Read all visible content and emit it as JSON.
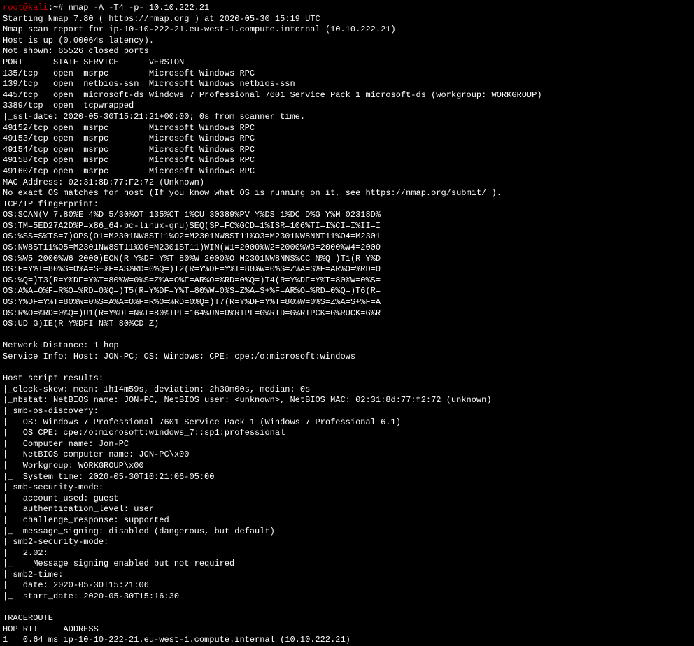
{
  "prompt": {
    "user": "root@kali",
    "cwd": "~",
    "hash": "#",
    "command": "nmap -A -T4 -p- 10.10.222.21"
  },
  "lines": [
    "Starting Nmap 7.80 ( https://nmap.org ) at 2020-05-30 15:19 UTC",
    "Nmap scan report for ip-10-10-222-21.eu-west-1.compute.internal (10.10.222.21)",
    "Host is up (0.00064s latency).",
    "Not shown: 65526 closed ports",
    "PORT      STATE SERVICE      VERSION",
    "135/tcp   open  msrpc        Microsoft Windows RPC",
    "139/tcp   open  netbios-ssn  Microsoft Windows netbios-ssn",
    "445/tcp   open  microsoft-ds Windows 7 Professional 7601 Service Pack 1 microsoft-ds (workgroup: WORKGROUP)",
    "3389/tcp  open  tcpwrapped",
    "|_ssl-date: 2020-05-30T15:21:21+00:00; 0s from scanner time.",
    "49152/tcp open  msrpc        Microsoft Windows RPC",
    "49153/tcp open  msrpc        Microsoft Windows RPC",
    "49154/tcp open  msrpc        Microsoft Windows RPC",
    "49158/tcp open  msrpc        Microsoft Windows RPC",
    "49160/tcp open  msrpc        Microsoft Windows RPC",
    "MAC Address: 02:31:8D:77:F2:72 (Unknown)",
    "No exact OS matches for host (If you know what OS is running on it, see https://nmap.org/submit/ ).",
    "TCP/IP fingerprint:",
    "OS:SCAN(V=7.80%E=4%D=5/30%OT=135%CT=1%CU=30389%PV=Y%DS=1%DC=D%G=Y%M=02318D%",
    "OS:TM=5ED27A2D%P=x86_64-pc-linux-gnu)SEQ(SP=FC%GCD=1%ISR=106%TI=I%CI=I%II=I",
    "OS:%SS=S%TS=7)OPS(O1=M2301NW8ST11%O2=M2301NW8ST11%O3=M2301NW8NNT11%O4=M2301",
    "OS:NW8ST11%O5=M2301NW8ST11%O6=M2301ST11)WIN(W1=2000%W2=2000%W3=2000%W4=2000",
    "OS:%W5=2000%W6=2000)ECN(R=Y%DF=Y%T=80%W=2000%O=M2301NW8NNS%CC=N%Q=)T1(R=Y%D",
    "OS:F=Y%T=80%S=O%A=S+%F=AS%RD=0%Q=)T2(R=Y%DF=Y%T=80%W=0%S=Z%A=S%F=AR%O=%RD=0",
    "OS:%Q=)T3(R=Y%DF=Y%T=80%W=0%S=Z%A=O%F=AR%O=%RD=0%Q=)T4(R=Y%DF=Y%T=80%W=0%S=",
    "OS:A%A=O%F=R%O=%RD=0%Q=)T5(R=Y%DF=Y%T=80%W=0%S=Z%A=S+%F=AR%O=%RD=0%Q=)T6(R=",
    "OS:Y%DF=Y%T=80%W=0%S=A%A=O%F=R%O=%RD=0%Q=)T7(R=Y%DF=Y%T=80%W=0%S=Z%A=S+%F=A",
    "OS:R%O=%RD=0%Q=)U1(R=Y%DF=N%T=80%IPL=164%UN=0%RIPL=G%RID=G%RIPCK=G%RUCK=G%R",
    "OS:UD=G)IE(R=Y%DFI=N%T=80%CD=Z)",
    "",
    "Network Distance: 1 hop",
    "Service Info: Host: JON-PC; OS: Windows; CPE: cpe:/o:microsoft:windows",
    "",
    "Host script results:",
    "|_clock-skew: mean: 1h14m59s, deviation: 2h30m00s, median: 0s",
    "|_nbstat: NetBIOS name: JON-PC, NetBIOS user: <unknown>, NetBIOS MAC: 02:31:8d:77:f2:72 (unknown)",
    "| smb-os-discovery: ",
    "|   OS: Windows 7 Professional 7601 Service Pack 1 (Windows 7 Professional 6.1)",
    "|   OS CPE: cpe:/o:microsoft:windows_7::sp1:professional",
    "|   Computer name: Jon-PC",
    "|   NetBIOS computer name: JON-PC\\x00",
    "|   Workgroup: WORKGROUP\\x00",
    "|_  System time: 2020-05-30T10:21:06-05:00",
    "| smb-security-mode: ",
    "|   account_used: guest",
    "|   authentication_level: user",
    "|   challenge_response: supported",
    "|_  message_signing: disabled (dangerous, but default)",
    "| smb2-security-mode: ",
    "|   2.02: ",
    "|_    Message signing enabled but not required",
    "| smb2-time: ",
    "|   date: 2020-05-30T15:21:06",
    "|_  start_date: 2020-05-30T15:16:30",
    "",
    "TRACEROUTE",
    "HOP RTT     ADDRESS",
    "1   0.64 ms ip-10-10-222-21.eu-west-1.compute.internal (10.10.222.21)"
  ]
}
